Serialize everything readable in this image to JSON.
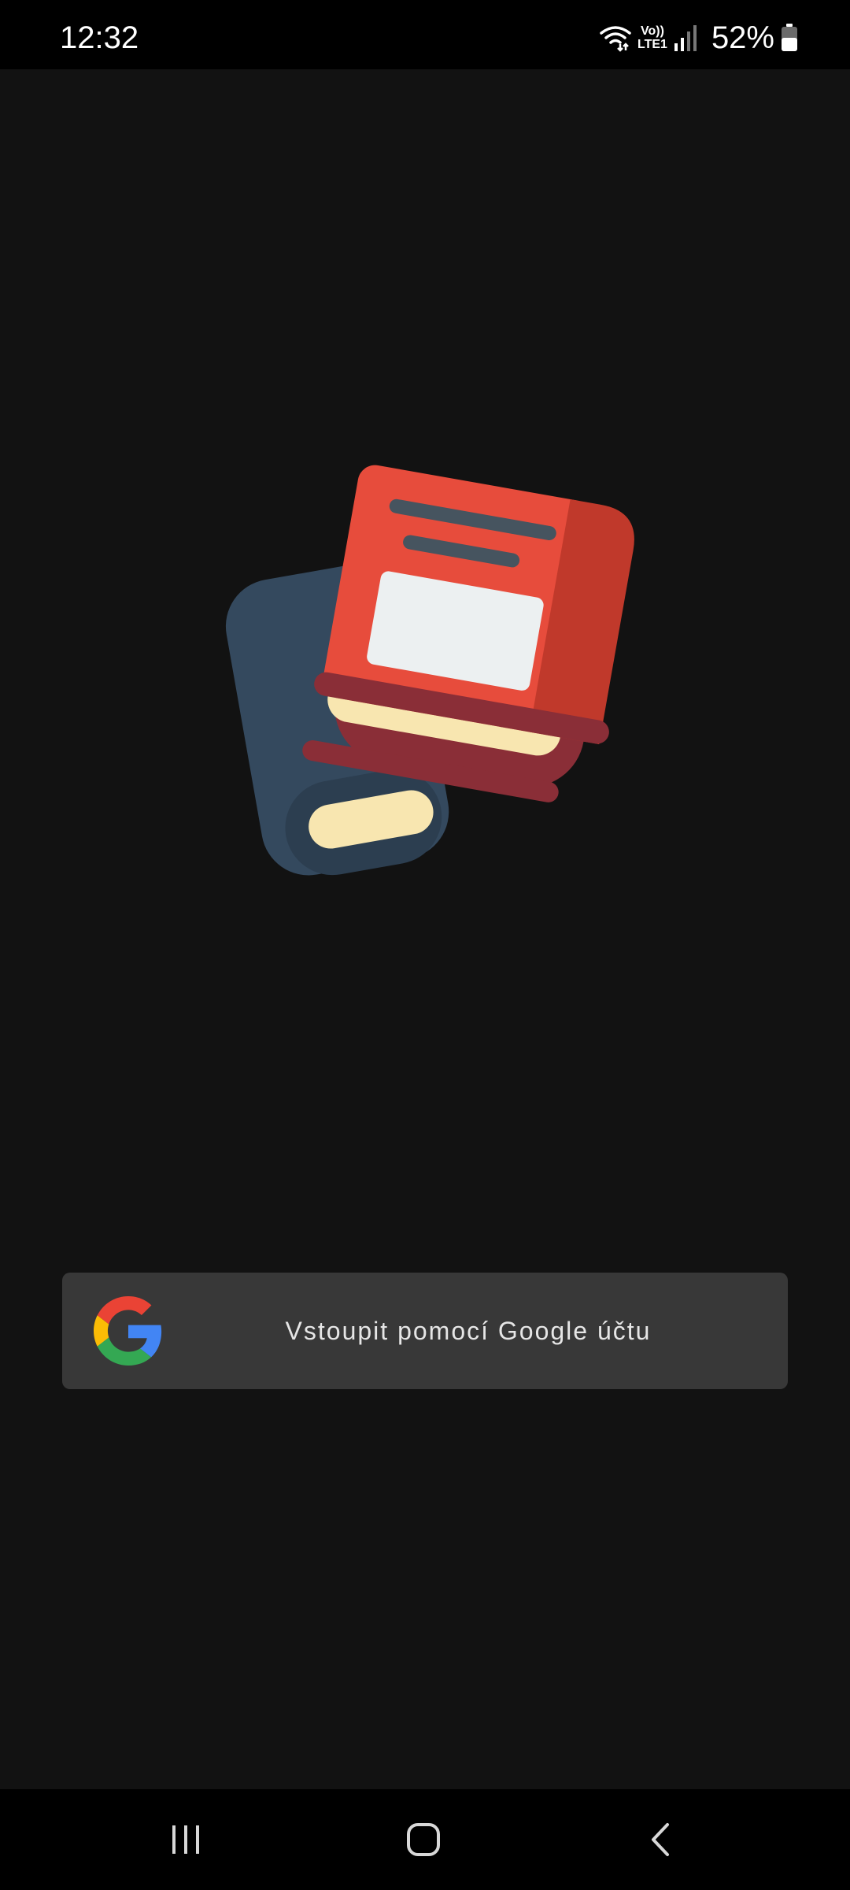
{
  "status_bar": {
    "time": "12:32",
    "volte_top": "Vo))",
    "volte_bottom": "LTE1",
    "battery_percent": "52%",
    "icons": [
      "wifi-icon",
      "signal-icon",
      "battery-icon"
    ]
  },
  "main": {
    "logo": "books-logo"
  },
  "login": {
    "google_button_label": "Vstoupit pomocí Google účtu",
    "google_icon": "google-g-icon"
  },
  "nav_bar": {
    "icons": [
      "recent-apps-icon",
      "home-icon",
      "back-icon"
    ]
  },
  "colors": {
    "background": "#121212",
    "button_bg": "#383838",
    "book_red": "#e74c3c",
    "book_dark_red": "#8a2e37",
    "book_back": "#34495e",
    "pages": "#f8e6b0"
  }
}
